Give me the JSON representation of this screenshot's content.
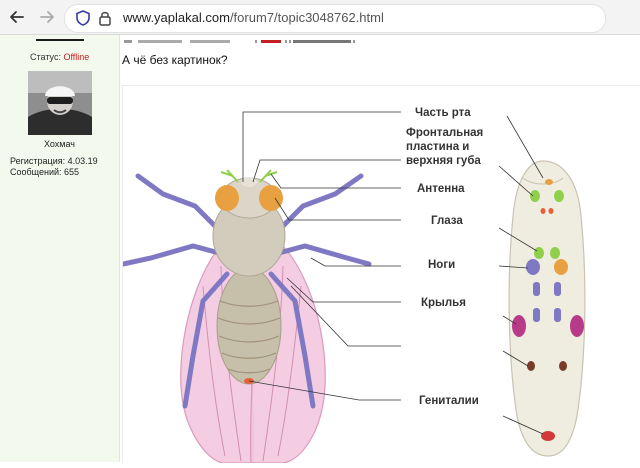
{
  "browser": {
    "url_domain": "www.yaplakal.com",
    "url_path": "/forum7/topic3048762.html"
  },
  "sidebar": {
    "status_label": "Статус:",
    "status_value": "Offline",
    "username": "Хохмач",
    "registration": "Регистрация: 4.03.19",
    "messages": "Сообщений: 655"
  },
  "post": {
    "text": "А чё без картинок?"
  },
  "figure": {
    "labels": {
      "mouthparts": "Часть рта",
      "frontal_1": "Фронтальная",
      "frontal_2": "пластина и",
      "frontal_3": "верхняя губа",
      "antenna": "Антенна",
      "eyes": "Глаза",
      "legs": "Ноги",
      "wings": "Крылья",
      "genitals": "Гениталии"
    },
    "colors": {
      "eye": "#e8a040",
      "leg": "#7f79c4",
      "wing": "#f2c6de",
      "wing_disc": "#b83b8a",
      "antenna": "#8fcf4a",
      "larva": "#efece0"
    }
  }
}
